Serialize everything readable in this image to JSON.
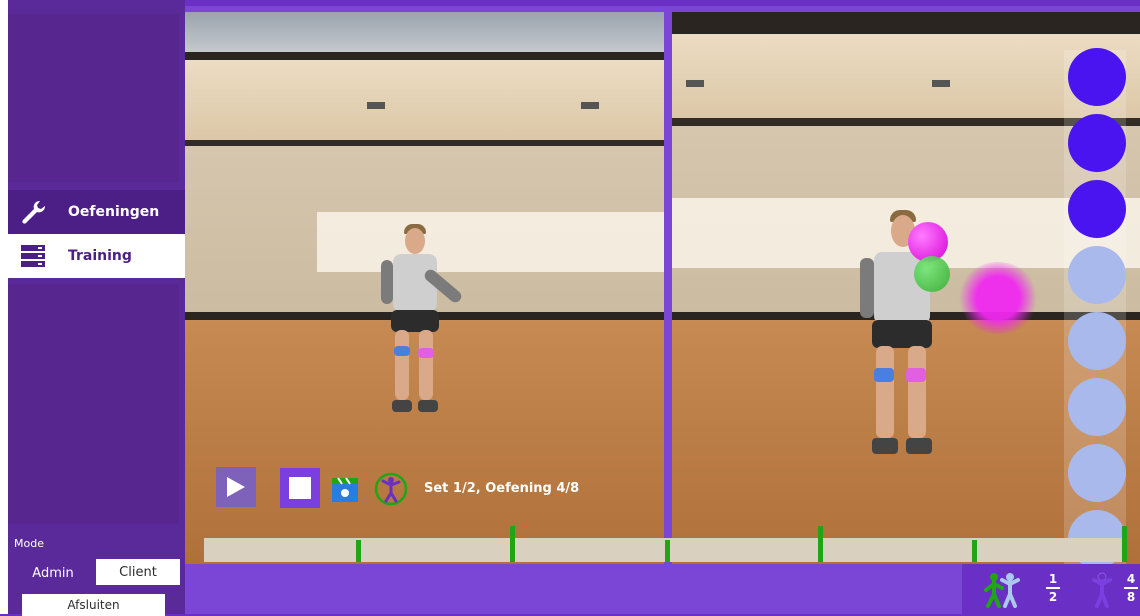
{
  "sidebar": {
    "items": [
      {
        "label": "Oefeningen",
        "icon": "wrench-icon"
      },
      {
        "label": "Training",
        "icon": "server-icon"
      }
    ],
    "mode": {
      "label": "Mode",
      "admin_label": "Admin",
      "client_label": "Client",
      "exit_label": "Afsluiten"
    }
  },
  "controls": {
    "play_icon": "play-icon",
    "stop_icon": "stop-icon",
    "set_label": "Set 1/2, Oefening 4/8"
  },
  "progress": {
    "sets": {
      "current": "1",
      "total": "2"
    },
    "exercises": {
      "current": "4",
      "total": "8"
    }
  },
  "indicators": {
    "total": 8,
    "completed": 3,
    "active_color": "#4a14f0",
    "inactive_color": "#a9b9ec"
  },
  "colors": {
    "sidebar": "#5b2a9a",
    "accent": "#7b45d6",
    "timeline_tick": "#1fa516"
  }
}
